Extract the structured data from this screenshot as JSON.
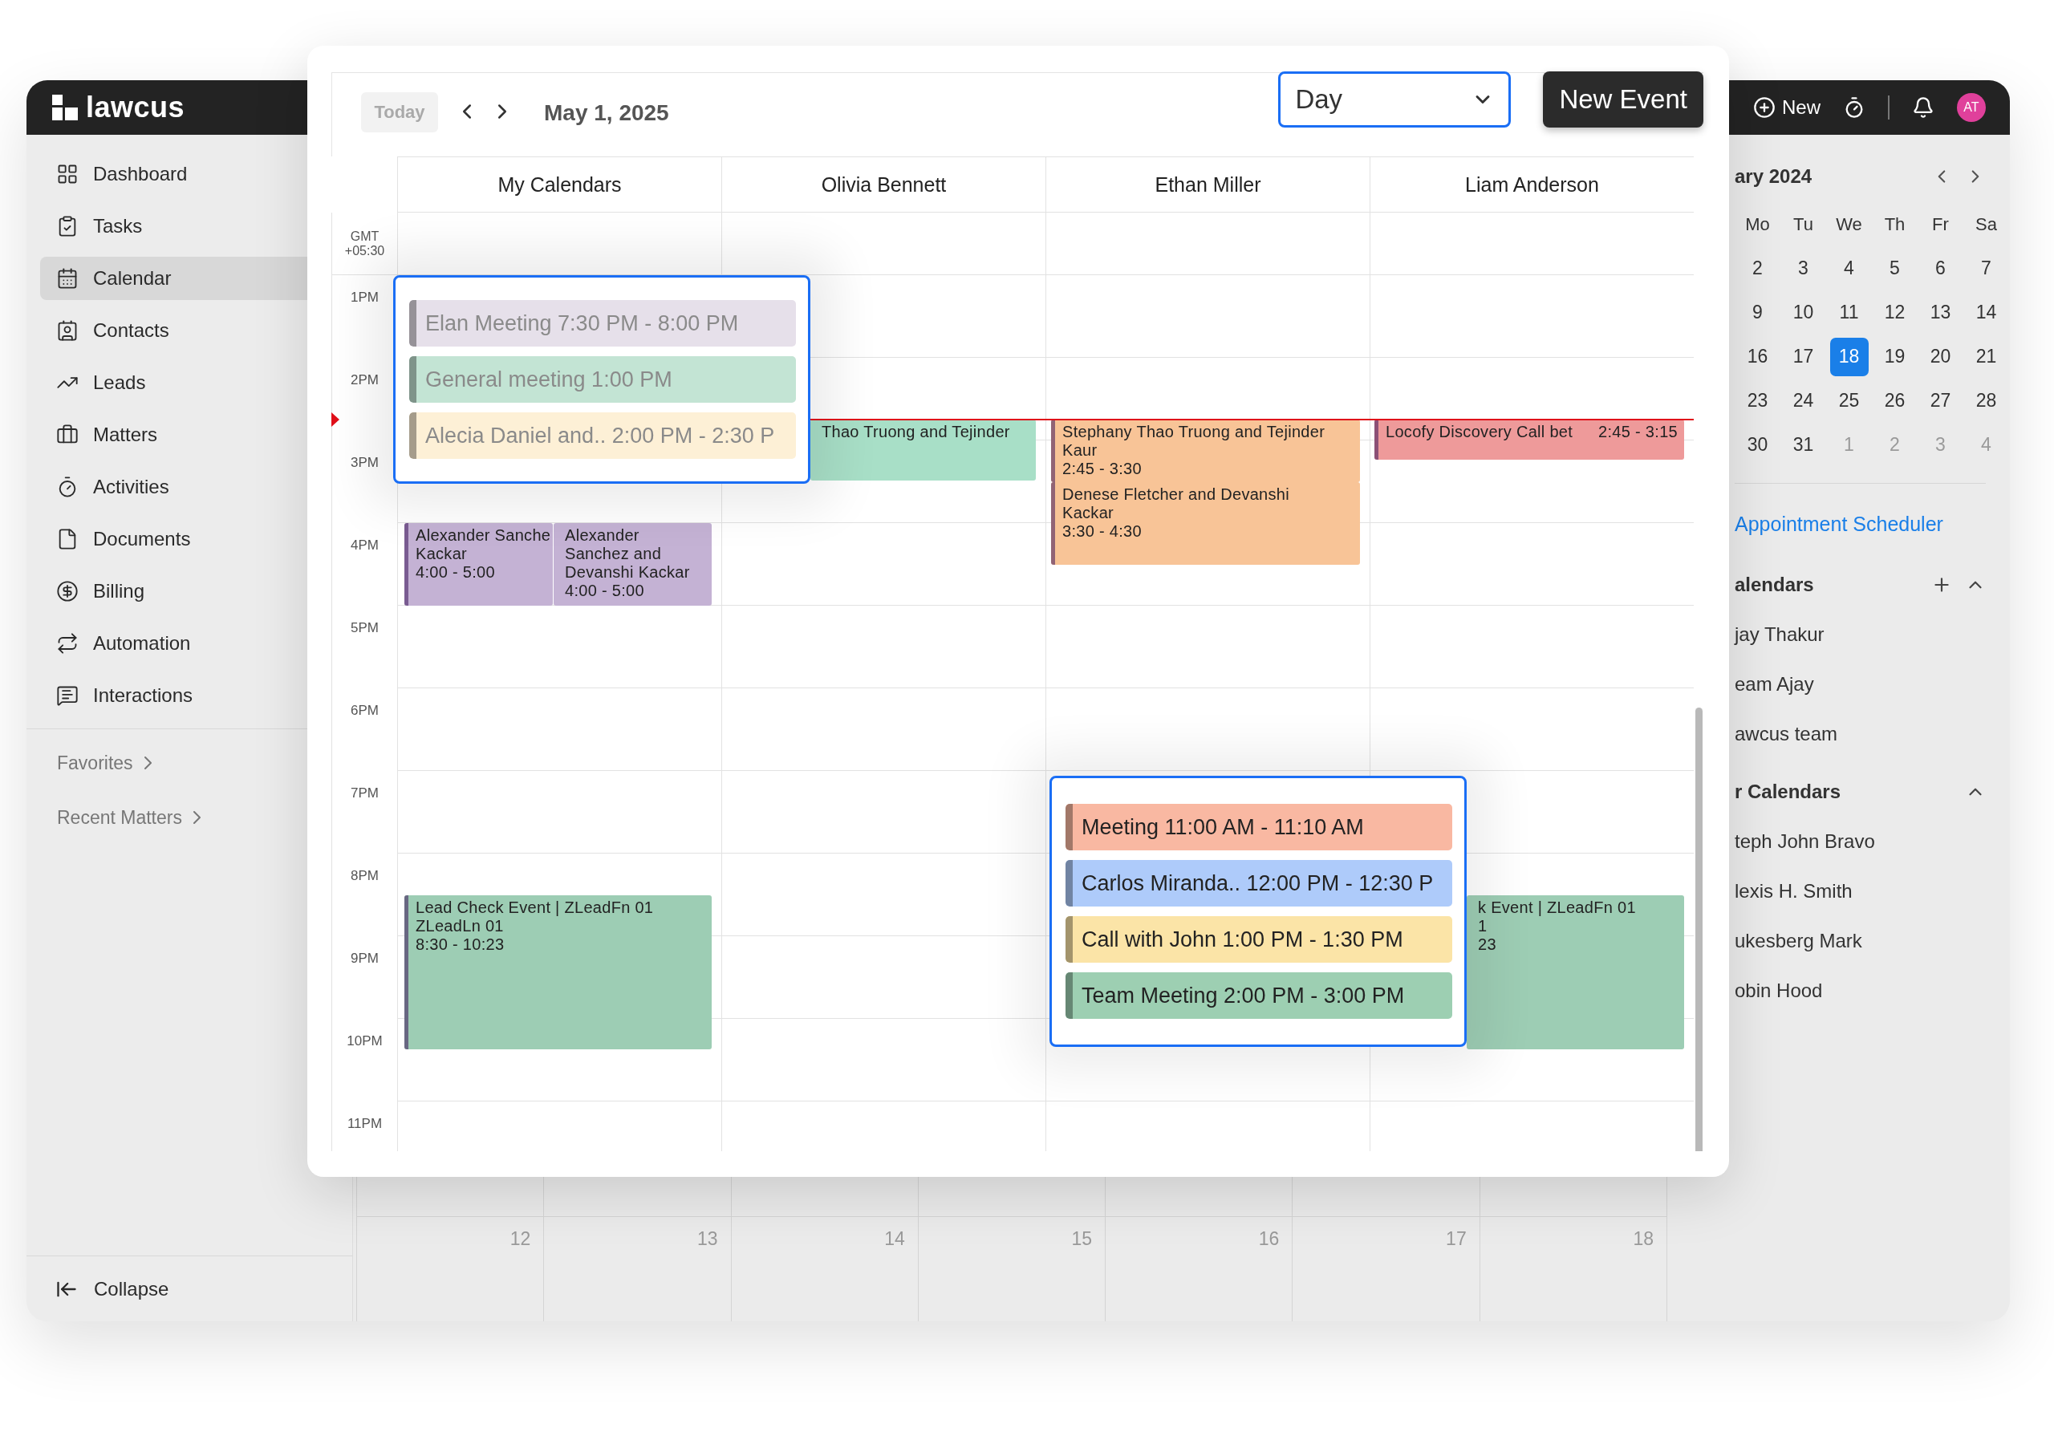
{
  "app": {
    "logo": "lawcus"
  },
  "header": {
    "new_label": "New",
    "avatar": "AT"
  },
  "sidebar": {
    "items": [
      {
        "label": "Dashboard",
        "selected": false
      },
      {
        "label": "Tasks",
        "selected": false
      },
      {
        "label": "Calendar",
        "selected": true
      },
      {
        "label": "Contacts",
        "selected": false
      },
      {
        "label": "Leads",
        "selected": false
      },
      {
        "label": "Matters",
        "selected": false
      },
      {
        "label": "Activities",
        "selected": false
      },
      {
        "label": "Documents",
        "selected": false
      },
      {
        "label": "Billing",
        "selected": false
      },
      {
        "label": "Automation",
        "selected": false
      },
      {
        "label": "Interactions",
        "selected": false
      }
    ],
    "links": [
      {
        "label": "Favorites"
      },
      {
        "label": "Recent Matters"
      }
    ],
    "collapse": "Collapse"
  },
  "toolbar": {
    "today": {
      "label": "Today",
      "disabled": true
    },
    "date": "May 1, 2025",
    "view": "Day",
    "new_event": "New Event"
  },
  "calendar": {
    "gmt": [
      "GMT",
      "+05:30"
    ],
    "hours": [
      "1PM",
      "2PM",
      "3PM",
      "4PM",
      "5PM",
      "6PM",
      "7PM",
      "8PM",
      "9PM",
      "10PM",
      "11PM"
    ],
    "columns": [
      {
        "name": "My Calendars",
        "events": [
          {
            "kind": "block",
            "lines": [
              "Alexander Sanche",
              "Kackar"
            ],
            "time": "4:00 - 5:00",
            "color": "#c4b2d4"
          },
          {
            "kind": "block",
            "lines": [
              "Alexander",
              "Sanchez and",
              "Devanshi Kackar"
            ],
            "time": "4:00 - 5:00",
            "color": "#c4b2d4"
          },
          {
            "kind": "block",
            "lines": [
              "Lead Check Event | ZLeadFn 01",
              "ZLeadLn 01"
            ],
            "time": "8:30 - 10:23",
            "color": "#9dcdb4"
          }
        ]
      },
      {
        "name": "Olivia Bennett",
        "events": [
          {
            "kind": "block",
            "lines": [
              "Thao Truong and Tejinder"
            ],
            "color": "#a8dfc7"
          }
        ]
      },
      {
        "name": "Ethan Miller",
        "events": [
          {
            "kind": "block",
            "lines": [
              "Stephany Thao Truong and Tejinder",
              "Kaur"
            ],
            "time": "2:45 - 3:30",
            "color": "#f8c497"
          },
          {
            "kind": "block",
            "lines": [
              "Denese Fletcher and Devanshi",
              "Kackar"
            ],
            "time": "3:30 - 4:30",
            "color": "#f8c497"
          }
        ]
      },
      {
        "name": "Liam Anderson",
        "events": [
          {
            "kind": "inline",
            "lines": [
              "Locofy Discovery Call bet"
            ],
            "time": "2:45 - 3:15",
            "color": "#ee9a9a"
          },
          {
            "kind": "block",
            "lines": [
              "k Event | ZLeadFn 01",
              "1"
            ],
            "time": "23",
            "color": "#9dcdb4"
          }
        ]
      }
    ]
  },
  "popups": [
    {
      "dimmed": true,
      "items": [
        {
          "text": "Elan Meeting 7:30 PM - 8:00 PM",
          "color": "#e6e0ea"
        },
        {
          "text": "General meeting 1:00 PM",
          "color": "#c3e4d4"
        },
        {
          "text": "Alecia Daniel and.. 2:00 PM - 2:30 P",
          "color": "#fdf0d6"
        }
      ]
    },
    {
      "dimmed": false,
      "items": [
        {
          "text": "Meeting  11:00 AM - 11:10 AM",
          "color": "#f9b8a2"
        },
        {
          "text": "Carlos Miranda..  12:00 PM - 12:30 P",
          "color": "#aecbfa"
        },
        {
          "text": "Call with John 1:00 PM - 1:30 PM",
          "color": "#fbe4a7"
        },
        {
          "text": "Team Meeting 2:00 PM - 3:00 PM",
          "color": "#9dcfb2"
        }
      ]
    }
  ],
  "mini_calendar": {
    "title": "ary 2024",
    "weekdays": [
      "Mo",
      "Tu",
      "We",
      "Th",
      "Fr",
      "Sa"
    ],
    "weeks": [
      [
        {
          "day": "2",
          "selected": false,
          "outside": false
        },
        {
          "day": "3",
          "selected": false,
          "outside": false
        },
        {
          "day": "4",
          "selected": false,
          "outside": false
        },
        {
          "day": "5",
          "selected": false,
          "outside": false
        },
        {
          "day": "6",
          "selected": false,
          "outside": false
        },
        {
          "day": "7",
          "selected": false,
          "outside": false
        }
      ],
      [
        {
          "day": "9",
          "selected": false,
          "outside": false
        },
        {
          "day": "10",
          "selected": false,
          "outside": false
        },
        {
          "day": "11",
          "selected": false,
          "outside": false
        },
        {
          "day": "12",
          "selected": false,
          "outside": false
        },
        {
          "day": "13",
          "selected": false,
          "outside": false
        },
        {
          "day": "14",
          "selected": false,
          "outside": false
        }
      ],
      [
        {
          "day": "16",
          "selected": false,
          "outside": false
        },
        {
          "day": "17",
          "selected": false,
          "outside": false
        },
        {
          "day": "18",
          "selected": true,
          "outside": false
        },
        {
          "day": "19",
          "selected": false,
          "outside": false
        },
        {
          "day": "20",
          "selected": false,
          "outside": false
        },
        {
          "day": "21",
          "selected": false,
          "outside": false
        }
      ],
      [
        {
          "day": "23",
          "selected": false,
          "outside": false
        },
        {
          "day": "24",
          "selected": false,
          "outside": false
        },
        {
          "day": "25",
          "selected": false,
          "outside": false
        },
        {
          "day": "26",
          "selected": false,
          "outside": false
        },
        {
          "day": "27",
          "selected": false,
          "outside": false
        },
        {
          "day": "28",
          "selected": false,
          "outside": false
        }
      ],
      [
        {
          "day": "30",
          "selected": false,
          "outside": false
        },
        {
          "day": "31",
          "selected": false,
          "outside": false
        },
        {
          "day": "1",
          "selected": false,
          "outside": true
        },
        {
          "day": "2",
          "selected": false,
          "outside": true
        },
        {
          "day": "3",
          "selected": false,
          "outside": true
        },
        {
          "day": "4",
          "selected": false,
          "outside": true
        }
      ]
    ]
  },
  "appointment_scheduler": "Appointment Scheduler",
  "calendar_groups": [
    {
      "title": "alendars",
      "addable": true,
      "expanded": true,
      "items": [
        "jay Thakur",
        "eam Ajay",
        "awcus team"
      ]
    },
    {
      "title": "r Calendars",
      "addable": false,
      "expanded": true,
      "items": [
        "teph John Bravo",
        "lexis H. Smith",
        "ukesberg Mark",
        "obin Hood"
      ]
    }
  ],
  "month_grid": {
    "days": [
      "12",
      "13",
      "14",
      "15",
      "16",
      "17",
      "18"
    ]
  }
}
